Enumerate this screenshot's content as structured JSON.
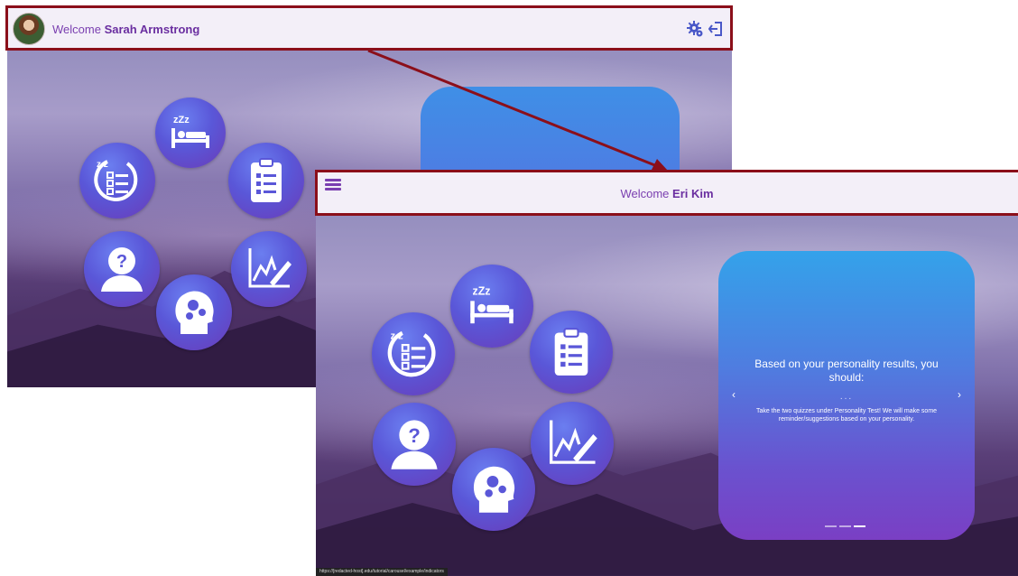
{
  "back": {
    "welcome_prefix": "Welcome",
    "user_name": "Sarah Armstrong",
    "icons": [
      "settings-gear-icon",
      "logout-icon"
    ],
    "features": [
      "sleep-icon",
      "checklist-icon",
      "task-list-icon",
      "progress-chart-icon",
      "help-icon",
      "brain-gears-icon"
    ]
  },
  "front": {
    "welcome_prefix": "Welcome",
    "user_name": "Eri Kim",
    "menu_icon": "hamburger-menu-icon",
    "features": [
      "sleep-icon",
      "checklist-icon",
      "task-list-icon",
      "progress-chart-icon",
      "help-icon",
      "brain-gears-icon"
    ],
    "carousel": {
      "title": "Based on your personality results, you should:",
      "ellipsis": "...",
      "body": "Take the two quizzes under Personality Test! We will make some reminder/suggestions based on your personality.",
      "prev": "‹",
      "next": "›",
      "slides": 3,
      "active_slide": 3
    },
    "status_url": "https://[redacted-host].edu/tutorial/carousel/example/indicators"
  },
  "colors": {
    "accent": "#7a3fb0",
    "highlight": "#8b0f1a",
    "circle": "#5a57d8"
  }
}
